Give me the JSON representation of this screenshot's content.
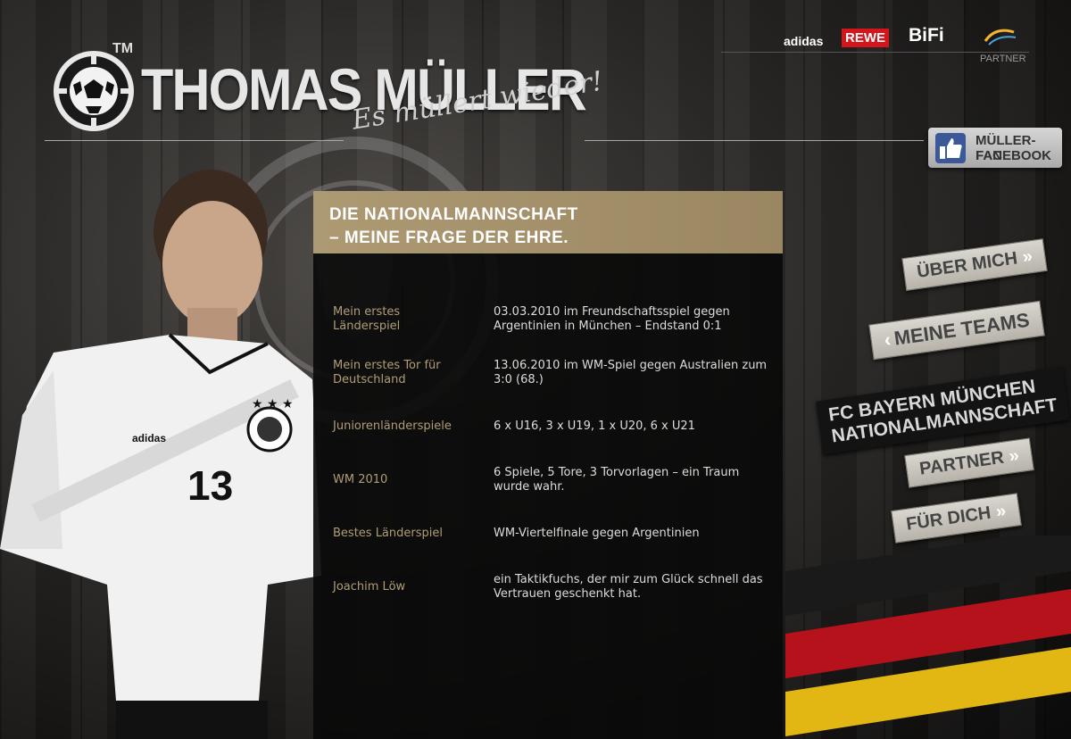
{
  "header": {
    "tm": "TM",
    "title": "THOMAS MÜLLER",
    "slogan": "Es müllert wieder!"
  },
  "partners": {
    "logos": {
      "adidas": "adidas",
      "rewe": "REWE",
      "bifi": "BiFi"
    },
    "label": "PARTNER"
  },
  "facebook": {
    "line1": "MÜLLER-FAN",
    "line2": "FACEBOOK"
  },
  "player": {
    "jersey_number": "13",
    "jersey_brand": "adidas"
  },
  "content": {
    "title_line1": "DIE NATIONALMANNSCHAFT",
    "title_line2": "– MEINE FRAGE DER EHRE.",
    "rows": [
      {
        "label": "Mein erstes Länderspiel",
        "value": "03.03.2010 im Freundschaftsspiel gegen Argentinien in München – Endstand 0:1"
      },
      {
        "label": "Mein erstes Tor für Deutschland",
        "value": "13.06.2010 im WM-Spiel gegen Australien zum 3:0 (68.)"
      },
      {
        "label": "Juniorenländerspiele",
        "value": "6 x U16, 3 x U19, 1 x U20, 6 x U21"
      },
      {
        "label": "WM 2010",
        "value": "6 Spiele, 5 Tore, 3 Torvorlagen – ein Traum wurde wahr."
      },
      {
        "label": "Bestes Länderspiel",
        "value": "WM-Viertelfinale gegen Argentinien"
      },
      {
        "label": "Joachim Löw",
        "value": "ein Taktikfuchs, der mir zum Glück schnell das Vertrauen geschenkt hat."
      }
    ]
  },
  "nav": {
    "ueber_mich": "ÜBER MICH",
    "meine_teams": "MEINE TEAMS",
    "fc_bayern": "FC BAYERN MÜNCHEN",
    "nationalmannschaft": "NATIONALMANNSCHAFT",
    "partner": "PARTNER",
    "fuer_dich": "FÜR DICH",
    "arrow_right": "»",
    "arrow_left": "‹"
  },
  "colors": {
    "accent_gold": "#ad9a73",
    "panel_bg": "#0a0a0a",
    "flag_red": "#b5121b",
    "flag_gold": "#e2b714"
  }
}
